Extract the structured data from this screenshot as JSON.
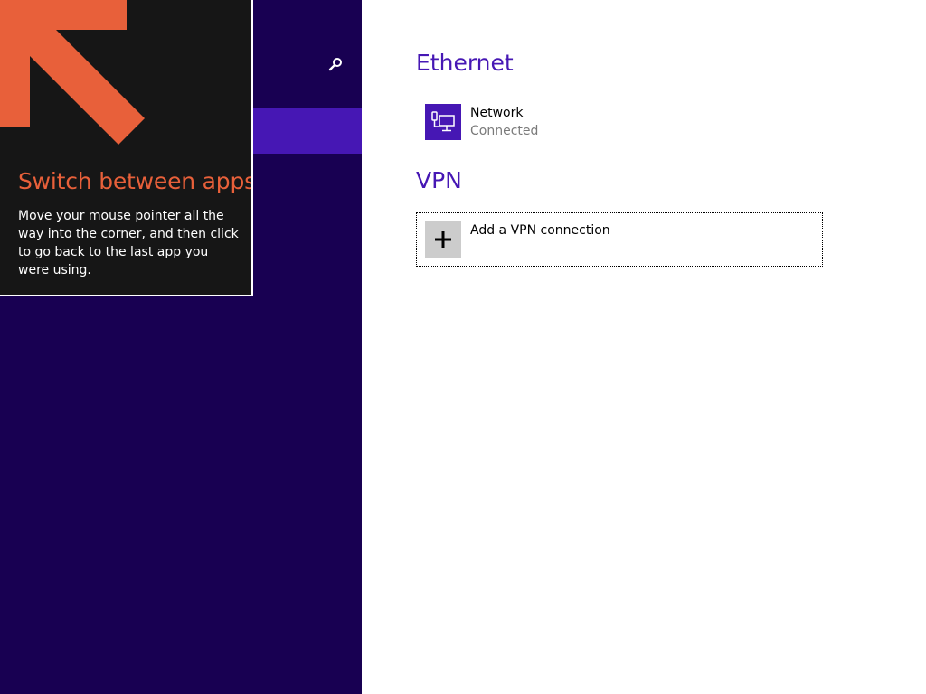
{
  "colors": {
    "nav_background": "#180052",
    "nav_selected": "#4617b4",
    "accent": "#4617b4",
    "tip_background": "#161616",
    "tip_accent": "#e8603a",
    "tile_gray": "#cccccc",
    "secondary_text": "#7a7a7a"
  },
  "nav": {
    "search_icon": "search-icon"
  },
  "tip": {
    "arrow_icon": "arrow-up-left-icon",
    "title": "Switch between apps",
    "body": "Move your mouse pointer all the way into the corner, and then click to go back to the last app you were using."
  },
  "ethernet": {
    "title": "Ethernet",
    "network": {
      "icon": "ethernet-network-icon",
      "name": "Network",
      "status": "Connected"
    }
  },
  "vpn": {
    "title": "VPN",
    "add": {
      "icon": "plus-icon",
      "label": "Add a VPN connection"
    }
  }
}
